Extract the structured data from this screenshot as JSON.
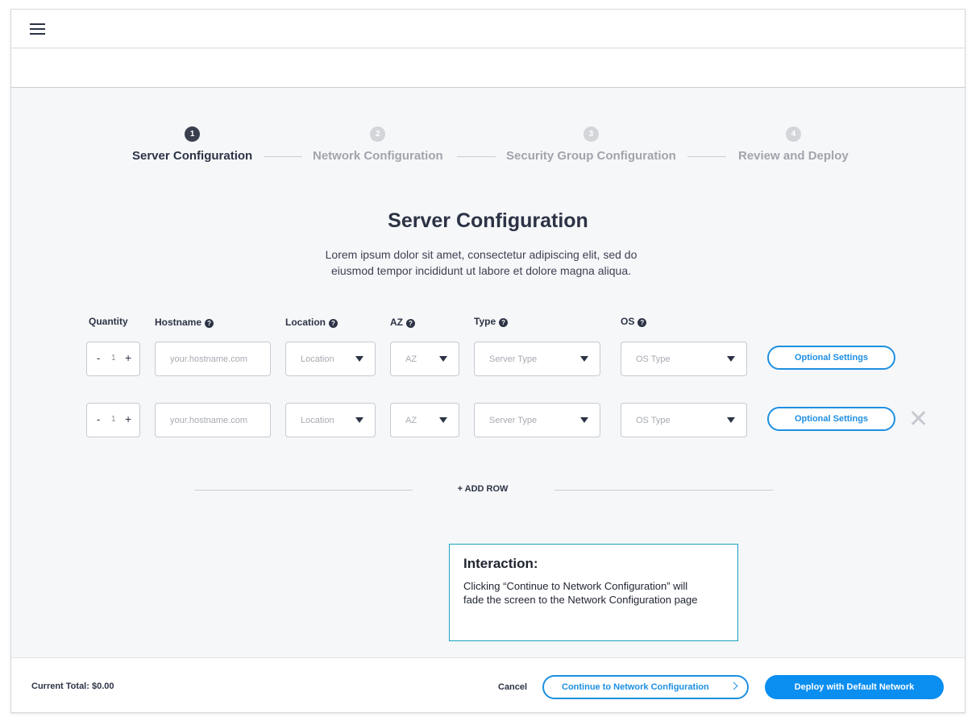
{
  "steps": [
    {
      "num": "1",
      "label": "Server Configuration"
    },
    {
      "num": "2",
      "label": "Network Configuration"
    },
    {
      "num": "3",
      "label": "Security Group Configuration"
    },
    {
      "num": "4",
      "label": "Review and Deploy"
    }
  ],
  "active_step": 1,
  "main": {
    "title": "Server Configuration",
    "description": "Lorem ipsum dolor sit amet, consectetur adipiscing elit, sed do eiusmod tempor incididunt ut labore et dolore magna aliqua."
  },
  "columns": {
    "quantity": "Quantity",
    "hostname": "Hostname",
    "location": "Location",
    "az": "AZ",
    "type": "Type",
    "os": "OS",
    "help": "?"
  },
  "rows": [
    {
      "qty_minus": "-",
      "qty_value": "1",
      "qty_plus": "+",
      "hostname_placeholder": "your.hostname.com",
      "location": "Location",
      "az": "AZ",
      "type": "Server Type",
      "os": "OS Type",
      "optional": "Optional Settings"
    },
    {
      "qty_minus": "-",
      "qty_value": "1",
      "qty_plus": "+",
      "hostname_placeholder": "your.hostname.com",
      "location": "Location",
      "az": "AZ",
      "type": "Server Type",
      "os": "OS Type",
      "optional": "Optional Settings"
    }
  ],
  "add_row_label": "+ ADD ROW",
  "note": {
    "heading": "Interaction:",
    "body": "Clicking “Continue to Network Configuration” will fade the screen to the Network Configuration page"
  },
  "footer": {
    "total": "Current Total: $0.00",
    "cancel": "Cancel",
    "continue": "Continue to Network Configuration",
    "deploy": "Deploy with Default Network"
  },
  "icons": {
    "menu": "hamburger-icon",
    "remove": "close-icon",
    "chevron": "chevron-right-icon"
  },
  "colors": {
    "accent": "#1d8fe1",
    "primary_button": "#0a8ef0",
    "text": "#2c3345",
    "note_border": "#1aa3bf"
  }
}
